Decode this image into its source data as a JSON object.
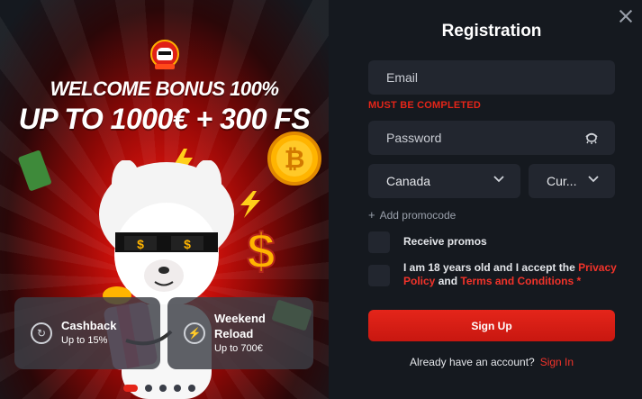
{
  "promo": {
    "title_line1": "WELCOME BONUS 100%",
    "title_line2": "UP TO 1000€ + 300 FS",
    "cards": [
      {
        "title": "Cashback",
        "subtitle": "Up to 15%"
      },
      {
        "title": "Weekend Reload",
        "subtitle": "Up to 700€"
      }
    ],
    "carousel": {
      "count": 5,
      "active": 1
    },
    "brand_color": "#e52519"
  },
  "form": {
    "heading": "Registration",
    "email_placeholder": "Email",
    "email_error": "MUST BE COMPLETED",
    "password_placeholder": "Password",
    "country_value": "Canada",
    "currency_value": "Cur...",
    "promocode_link": "Add promocode",
    "receive_promos_label": "Receive promos",
    "terms": {
      "prefix": "I am 18 years old and I accept the ",
      "privacy_link": "Privacy Policy",
      "and": " and ",
      "terms_link": "Terms and Conditions",
      "required_mark": " *"
    },
    "signup_label": "Sign Up",
    "have_account_text": "Already have an account?",
    "signin_link": "Sign In",
    "accent_color": "#e52519"
  }
}
